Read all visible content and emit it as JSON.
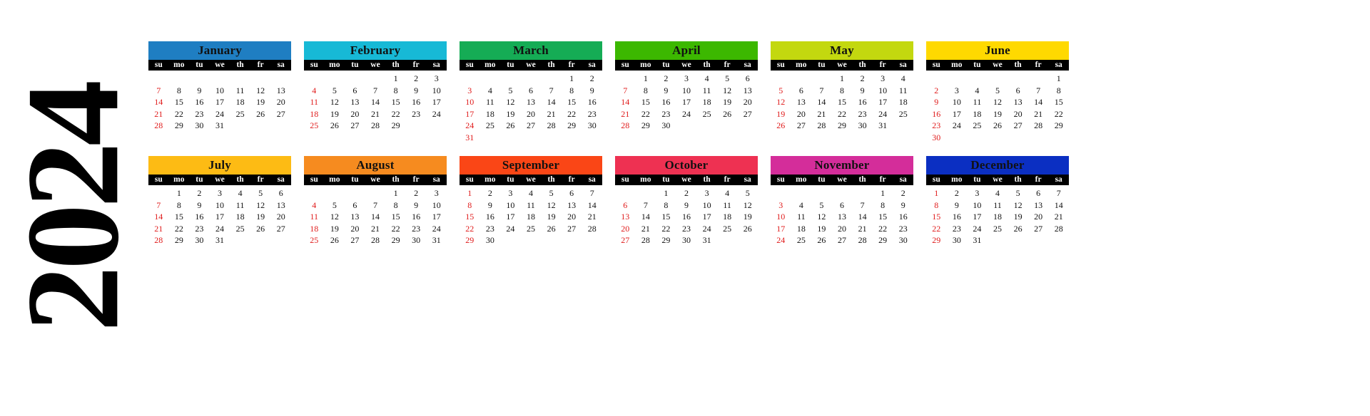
{
  "year": {
    "label": "2024"
  },
  "weekday_headers": [
    "su",
    "mo",
    "tu",
    "we",
    "th",
    "fr",
    "sa"
  ],
  "colors": {
    "sunday_text": "#e01b1b",
    "weekday_bar": "#000000",
    "weekday_text": "#ffffff",
    "day_text": "#111111",
    "page_background": "#ffffff"
  },
  "months": [
    {
      "name": "January",
      "header_color": "#1f7ec2",
      "weeks": [
        [
          "",
          "",
          "",
          "",
          "",
          "",
          ""
        ],
        [
          "7",
          "8",
          "9",
          "10",
          "11",
          "12",
          "13"
        ],
        [
          "14",
          "15",
          "16",
          "17",
          "18",
          "19",
          "20"
        ],
        [
          "21",
          "22",
          "23",
          "24",
          "25",
          "26",
          "27"
        ],
        [
          "28",
          "29",
          "30",
          "31",
          "",
          "",
          ""
        ]
      ]
    },
    {
      "name": "February",
      "header_color": "#17b9d6",
      "weeks": [
        [
          "",
          "",
          "",
          "",
          "1",
          "2",
          "3"
        ],
        [
          "4",
          "5",
          "6",
          "7",
          "8",
          "9",
          "10"
        ],
        [
          "11",
          "12",
          "13",
          "14",
          "15",
          "16",
          "17"
        ],
        [
          "18",
          "19",
          "20",
          "21",
          "22",
          "23",
          "24"
        ],
        [
          "25",
          "26",
          "27",
          "28",
          "29",
          "",
          ""
        ]
      ]
    },
    {
      "name": "March",
      "header_color": "#15ac55",
      "weeks": [
        [
          "",
          "",
          "",
          "",
          "",
          "1",
          "2"
        ],
        [
          "3",
          "4",
          "5",
          "6",
          "7",
          "8",
          "9"
        ],
        [
          "10",
          "11",
          "12",
          "13",
          "14",
          "15",
          "16"
        ],
        [
          "17",
          "18",
          "19",
          "20",
          "21",
          "22",
          "23"
        ],
        [
          "24",
          "25",
          "26",
          "27",
          "28",
          "29",
          "30"
        ],
        [
          "31",
          "",
          "",
          "",
          "",
          "",
          ""
        ]
      ]
    },
    {
      "name": "April",
      "header_color": "#3cb800",
      "weeks": [
        [
          "",
          "1",
          "2",
          "3",
          "4",
          "5",
          "6"
        ],
        [
          "7",
          "8",
          "9",
          "10",
          "11",
          "12",
          "13"
        ],
        [
          "14",
          "15",
          "16",
          "17",
          "18",
          "19",
          "20"
        ],
        [
          "21",
          "22",
          "23",
          "24",
          "25",
          "26",
          "27"
        ],
        [
          "28",
          "29",
          "30",
          "",
          "",
          "",
          ""
        ]
      ]
    },
    {
      "name": "May",
      "header_color": "#c3d80f",
      "weeks": [
        [
          "",
          "",
          "",
          "1",
          "2",
          "3",
          "4"
        ],
        [
          "5",
          "6",
          "7",
          "8",
          "9",
          "10",
          "11"
        ],
        [
          "12",
          "13",
          "14",
          "15",
          "16",
          "17",
          "18"
        ],
        [
          "19",
          "20",
          "21",
          "22",
          "23",
          "24",
          "25"
        ],
        [
          "26",
          "27",
          "28",
          "29",
          "30",
          "31",
          ""
        ]
      ]
    },
    {
      "name": "June",
      "header_color": "#ffd900",
      "weeks": [
        [
          "",
          "",
          "",
          "",
          "",
          "",
          "1"
        ],
        [
          "2",
          "3",
          "4",
          "5",
          "6",
          "7",
          "8"
        ],
        [
          "9",
          "10",
          "11",
          "12",
          "13",
          "14",
          "15"
        ],
        [
          "16",
          "17",
          "18",
          "19",
          "20",
          "21",
          "22"
        ],
        [
          "23",
          "24",
          "25",
          "26",
          "27",
          "28",
          "29"
        ],
        [
          "30",
          "",
          "",
          "",
          "",
          "",
          ""
        ]
      ]
    },
    {
      "name": "July",
      "header_color": "#fdbb14",
      "weeks": [
        [
          "",
          "1",
          "2",
          "3",
          "4",
          "5",
          "6"
        ],
        [
          "7",
          "8",
          "9",
          "10",
          "11",
          "12",
          "13"
        ],
        [
          "14",
          "15",
          "16",
          "17",
          "18",
          "19",
          "20"
        ],
        [
          "21",
          "22",
          "23",
          "24",
          "25",
          "26",
          "27"
        ],
        [
          "28",
          "29",
          "30",
          "31",
          "",
          "",
          ""
        ]
      ]
    },
    {
      "name": "August",
      "header_color": "#f68b1f",
      "weeks": [
        [
          "",
          "",
          "",
          "",
          "1",
          "2",
          "3"
        ],
        [
          "4",
          "5",
          "6",
          "7",
          "8",
          "9",
          "10"
        ],
        [
          "11",
          "12",
          "13",
          "14",
          "15",
          "16",
          "17"
        ],
        [
          "18",
          "19",
          "20",
          "21",
          "22",
          "23",
          "24"
        ],
        [
          "25",
          "26",
          "27",
          "28",
          "29",
          "30",
          "31"
        ]
      ]
    },
    {
      "name": "September",
      "header_color": "#fa4616",
      "weeks": [
        [
          "1",
          "2",
          "3",
          "4",
          "5",
          "6",
          "7"
        ],
        [
          "8",
          "9",
          "10",
          "11",
          "12",
          "13",
          "14"
        ],
        [
          "15",
          "16",
          "17",
          "18",
          "19",
          "20",
          "21"
        ],
        [
          "22",
          "23",
          "24",
          "25",
          "26",
          "27",
          "28"
        ],
        [
          "29",
          "30",
          "",
          "",
          "",
          "",
          ""
        ]
      ]
    },
    {
      "name": "October",
      "header_color": "#ee3152",
      "weeks": [
        [
          "",
          "",
          "1",
          "2",
          "3",
          "4",
          "5"
        ],
        [
          "6",
          "7",
          "8",
          "9",
          "10",
          "11",
          "12"
        ],
        [
          "13",
          "14",
          "15",
          "16",
          "17",
          "18",
          "19"
        ],
        [
          "20",
          "21",
          "22",
          "23",
          "24",
          "25",
          "26"
        ],
        [
          "27",
          "28",
          "29",
          "30",
          "31",
          "",
          ""
        ]
      ]
    },
    {
      "name": "November",
      "header_color": "#d42d9a",
      "weeks": [
        [
          "",
          "",
          "",
          "",
          "",
          "1",
          "2"
        ],
        [
          "3",
          "4",
          "5",
          "6",
          "7",
          "8",
          "9"
        ],
        [
          "10",
          "11",
          "12",
          "13",
          "14",
          "15",
          "16"
        ],
        [
          "17",
          "18",
          "19",
          "20",
          "21",
          "22",
          "23"
        ],
        [
          "24",
          "25",
          "26",
          "27",
          "28",
          "29",
          "30"
        ]
      ]
    },
    {
      "name": "December",
      "header_color": "#0b2fc2",
      "weeks": [
        [
          "1",
          "2",
          "3",
          "4",
          "5",
          "6",
          "7"
        ],
        [
          "8",
          "9",
          "10",
          "11",
          "12",
          "13",
          "14"
        ],
        [
          "15",
          "16",
          "17",
          "18",
          "19",
          "20",
          "21"
        ],
        [
          "22",
          "23",
          "24",
          "25",
          "26",
          "27",
          "28"
        ],
        [
          "29",
          "30",
          "31",
          "",
          "",
          "",
          ""
        ]
      ]
    }
  ]
}
